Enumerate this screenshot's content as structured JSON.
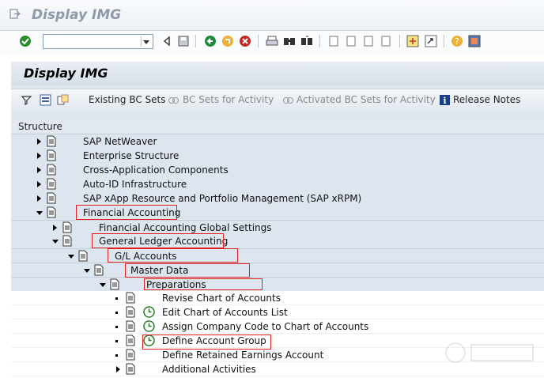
{
  "window": {
    "title": "Display IMG"
  },
  "panel": {
    "title": "Display IMG"
  },
  "app_toolbar": {
    "existing_bc_sets": "Existing BC Sets",
    "bc_sets_activity": "BC Sets for Activity",
    "activated_bc_sets": "Activated BC Sets for Activity",
    "release_notes": "Release Notes"
  },
  "tree": {
    "header": "Structure",
    "rows": [
      {
        "label": "SAP NetWeaver"
      },
      {
        "label": "Enterprise Structure"
      },
      {
        "label": "Cross-Application Components"
      },
      {
        "label": "Auto-ID Infrastructure"
      },
      {
        "label": "SAP xApp Resource and Portfolio Management (SAP xRPM)"
      },
      {
        "label": "Financial Accounting"
      },
      {
        "label": "Financial Accounting Global Settings"
      },
      {
        "label": "General Ledger Accounting"
      },
      {
        "label": "G/L Accounts"
      },
      {
        "label": "Master Data"
      },
      {
        "label": "Preparations"
      },
      {
        "label": "Revise Chart of Accounts"
      },
      {
        "label": "Edit Chart of Accounts List"
      },
      {
        "label": "Assign Company Code to Chart of Accounts"
      },
      {
        "label": "Define Account Group"
      },
      {
        "label": "Define Retained Earnings Account"
      },
      {
        "label": "Additional Activities"
      }
    ]
  },
  "colors": {
    "highlight": "#e02020",
    "tree_blue": "#dde5ee",
    "title_gray": "#8e9aa8"
  }
}
